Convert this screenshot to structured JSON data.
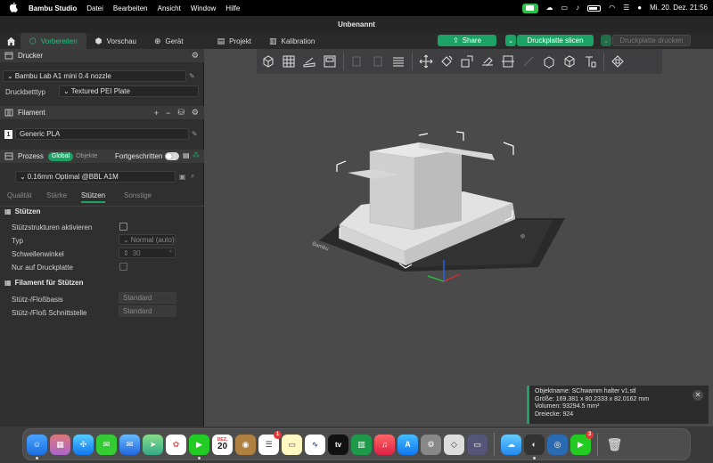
{
  "menubar": {
    "app_name": "Bambu Studio",
    "menus": [
      "Datei",
      "Bearbeiten",
      "Ansicht",
      "Window",
      "Hilfe"
    ],
    "clock": "Mi. 20. Dez.  21:56"
  },
  "window": {
    "title": "Unbenannt"
  },
  "tabs": [
    {
      "label": "Vorbereiten",
      "icon": "cube-icon",
      "active": true
    },
    {
      "label": "Vorschau",
      "icon": "preview-cube-icon"
    },
    {
      "label": "Gerät",
      "icon": "device-icon"
    },
    {
      "label": "Projekt",
      "icon": "project-icon"
    },
    {
      "label": "Kalibration",
      "icon": "calibration-icon"
    }
  ],
  "actions": {
    "share_label": "Share",
    "slice_label": "Druckplatte slicen",
    "print_label": "Druckplatte drucken"
  },
  "printer": {
    "header": "Drucker",
    "model": "Bambu Lab A1 mini 0.4 nozzle",
    "bed_label": "Druckbetttyp",
    "bed_value": "Textured PEI Plate"
  },
  "filament": {
    "header": "Filament",
    "slot_number": "1",
    "name": "Generic PLA"
  },
  "process": {
    "header": "Prozess",
    "toggle_global": "Global",
    "toggle_objects": "Objekte",
    "advanced_label": "Fortgeschritten",
    "profile": "0.16mm Optimal @BBL A1M",
    "subtabs": [
      "Qualität",
      "Stärke",
      "Stützen",
      "Sonstige"
    ],
    "active_subtab": "Stützen"
  },
  "supports": {
    "header": "Stützen",
    "enable_label": "Stützstrukturen aktivieren",
    "type_label": "Typ",
    "type_value": "Normal (auto)",
    "threshold_label": "Schwellenwinkel",
    "threshold_value": "30",
    "buildplate_only_label": "Nur auf Druckplatte"
  },
  "filament_supports": {
    "header": "Filament für Stützen",
    "base_label": "Stütz-/Floßbasis",
    "base_value": "Standard",
    "interface_label": "Stütz-/Floß Schnittstelle",
    "interface_value": "Standard"
  },
  "bed_logo": "Bambu",
  "object_info": {
    "line1": "Objektname: SChwamm halter v1.stl",
    "line2": "Größe: 169.381 x 80.2333 x 82.0162 mm",
    "line3": "Volumen: 93294.5 mm³",
    "line4": "Dreiecke: 924"
  },
  "dock": {
    "calendar_month": "DEZ.",
    "calendar_day": "20",
    "reminders_badge": "1",
    "facetime_badge": "3",
    "tv_label": "tv"
  },
  "colors": {
    "accent": "#1da265",
    "viewport": "#4a4a4b",
    "panel": "#2f2f2f"
  }
}
